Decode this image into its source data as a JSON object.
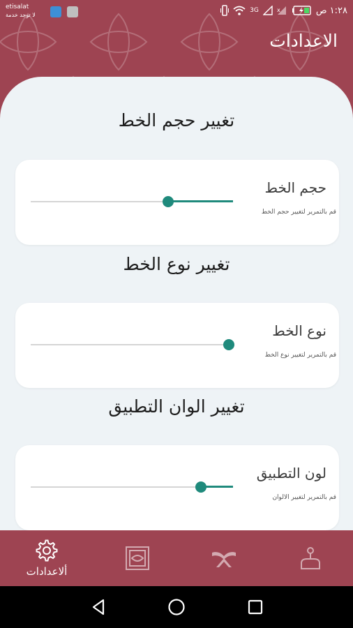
{
  "status_bar": {
    "carrier": "etisalat",
    "carrier_sub": "لا توجد خدمة",
    "time": "١:٢٨ ص",
    "network": "3G"
  },
  "header": {
    "title": "الاعدادات"
  },
  "sections": [
    {
      "title": "تغيير حجم الخط",
      "label": "حجم الخط",
      "hint": "قم بالتمرير لتغيير حجم الخط",
      "slider_value": 0.68
    },
    {
      "title": "تغيير نوع الخط",
      "label": "نوع الخط",
      "hint": "قم بالتمرير لتغيير نوع الخط",
      "slider_value": 0.98
    },
    {
      "title": "تغيير الوان التطبيق",
      "label": "لون التطبيق",
      "hint": "قم بالتمرير لتغيير الالوان",
      "slider_value": 0.84
    }
  ],
  "bottom_nav": {
    "items": [
      {
        "label": "ألاعدادات",
        "icon": "gear-icon",
        "active": true
      },
      {
        "label": "",
        "icon": "quran-frame-icon",
        "active": false
      },
      {
        "label": "",
        "icon": "book-stand-icon",
        "active": false
      },
      {
        "label": "",
        "icon": "prayer-icon",
        "active": false
      }
    ]
  },
  "colors": {
    "primary": "#9e4452",
    "accent": "#1f8a7c",
    "background": "#eef3f6"
  }
}
